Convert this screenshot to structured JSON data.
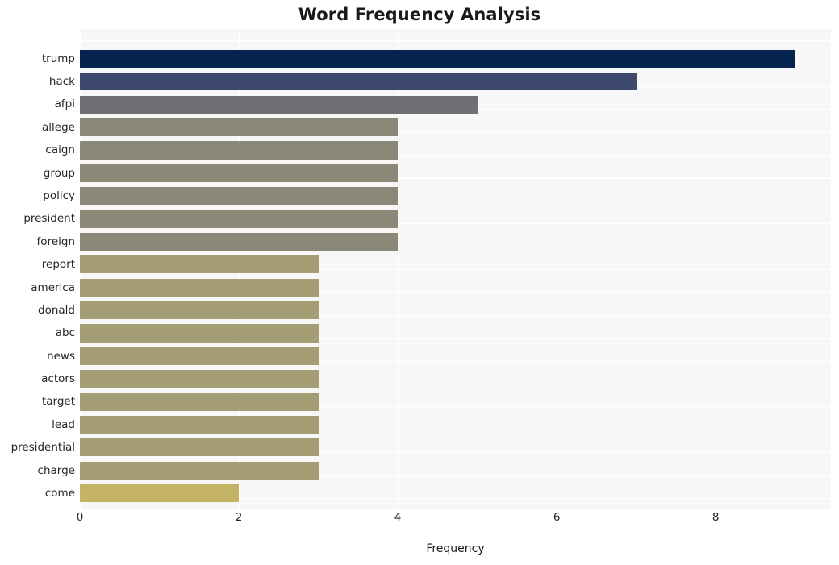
{
  "chart_data": {
    "type": "bar",
    "orientation": "horizontal",
    "title": "Word Frequency Analysis",
    "xlabel": "Frequency",
    "ylabel": "",
    "categories": [
      "trump",
      "hack",
      "afpi",
      "allege",
      "caign",
      "group",
      "policy",
      "president",
      "foreign",
      "report",
      "america",
      "donald",
      "abc",
      "news",
      "actors",
      "target",
      "lead",
      "presidential",
      "charge",
      "come"
    ],
    "values": [
      9,
      7,
      5,
      4,
      4,
      4,
      4,
      4,
      4,
      3,
      3,
      3,
      3,
      3,
      3,
      3,
      3,
      3,
      3,
      2
    ],
    "bar_colors": [
      "#04234f",
      "#3d4a6d",
      "#6e7074",
      "#8b8878",
      "#8b8878",
      "#8b8878",
      "#8b8878",
      "#8b8878",
      "#8b8878",
      "#a59d74",
      "#a59d74",
      "#a59d74",
      "#a59d74",
      "#a59d74",
      "#a59d74",
      "#a59d74",
      "#a59d74",
      "#a59d74",
      "#a59d74",
      "#c4b265"
    ],
    "xlim": [
      0,
      9.45
    ],
    "ylim_categories_top_to_bottom": true,
    "xticks": [
      0,
      2,
      4,
      6,
      8
    ],
    "xtick_labels": [
      "0",
      "2",
      "4",
      "6",
      "8"
    ],
    "grid": true,
    "grid_color": "#ffffff",
    "plot_background": "#f7f7f7",
    "figure_background": "#ffffff",
    "legend": null,
    "legend_position": "none",
    "annotations": []
  }
}
